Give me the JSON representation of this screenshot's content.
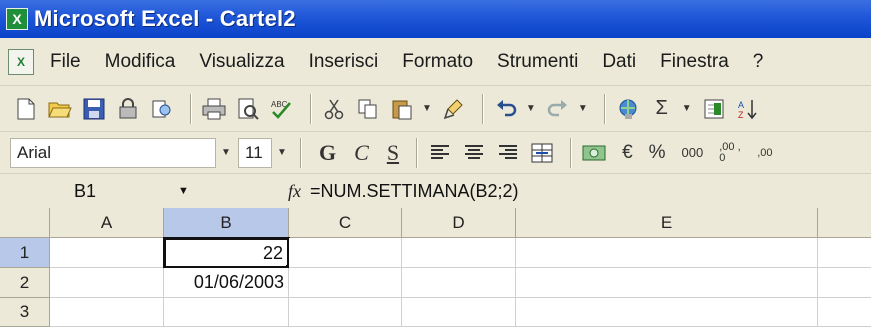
{
  "window": {
    "title": "Microsoft Excel - Cartel2",
    "app_icon": "excel-icon"
  },
  "menu": {
    "doc_icon": "workbook-icon",
    "items": [
      "File",
      "Modifica",
      "Visualizza",
      "Inserisci",
      "Formato",
      "Strumenti",
      "Dati",
      "Finestra",
      "?"
    ]
  },
  "toolbar_standard": {
    "buttons": [
      "new-icon",
      "open-icon",
      "save-icon",
      "permission-icon",
      "research-icon",
      "print-icon",
      "print-preview-icon",
      "spelling-icon",
      "cut-icon",
      "copy-icon",
      "paste-icon",
      "format-painter-icon",
      "undo-icon",
      "redo-icon",
      "hyperlink-icon",
      "autosum-icon",
      "function-icon",
      "sort-ascending-icon"
    ],
    "autosum_symbol": "Σ"
  },
  "toolbar_formatting": {
    "font": "Arial",
    "size": "11",
    "bold": "G",
    "italic": "C",
    "underline": "S",
    "euro": "€",
    "percent": "%",
    "thousands": "000",
    "increase_decimal": ",00 ,0",
    "decrease_decimal": ",00"
  },
  "formula_bar": {
    "name_box": "B1",
    "fx": "fx",
    "formula": "=NUM.SETTIMANA(B2;2)"
  },
  "sheet": {
    "columns": [
      "A",
      "B",
      "C",
      "D",
      "E"
    ],
    "rows": [
      "1",
      "2",
      "3"
    ],
    "selected_column": "B",
    "selected_row": "1",
    "cells": {
      "B1": "22",
      "B2": "01/06/2003"
    }
  },
  "colors": {
    "titlebar": "#1f56d8",
    "chrome": "#ece9d8",
    "selected_header": "#b8c8e8"
  }
}
